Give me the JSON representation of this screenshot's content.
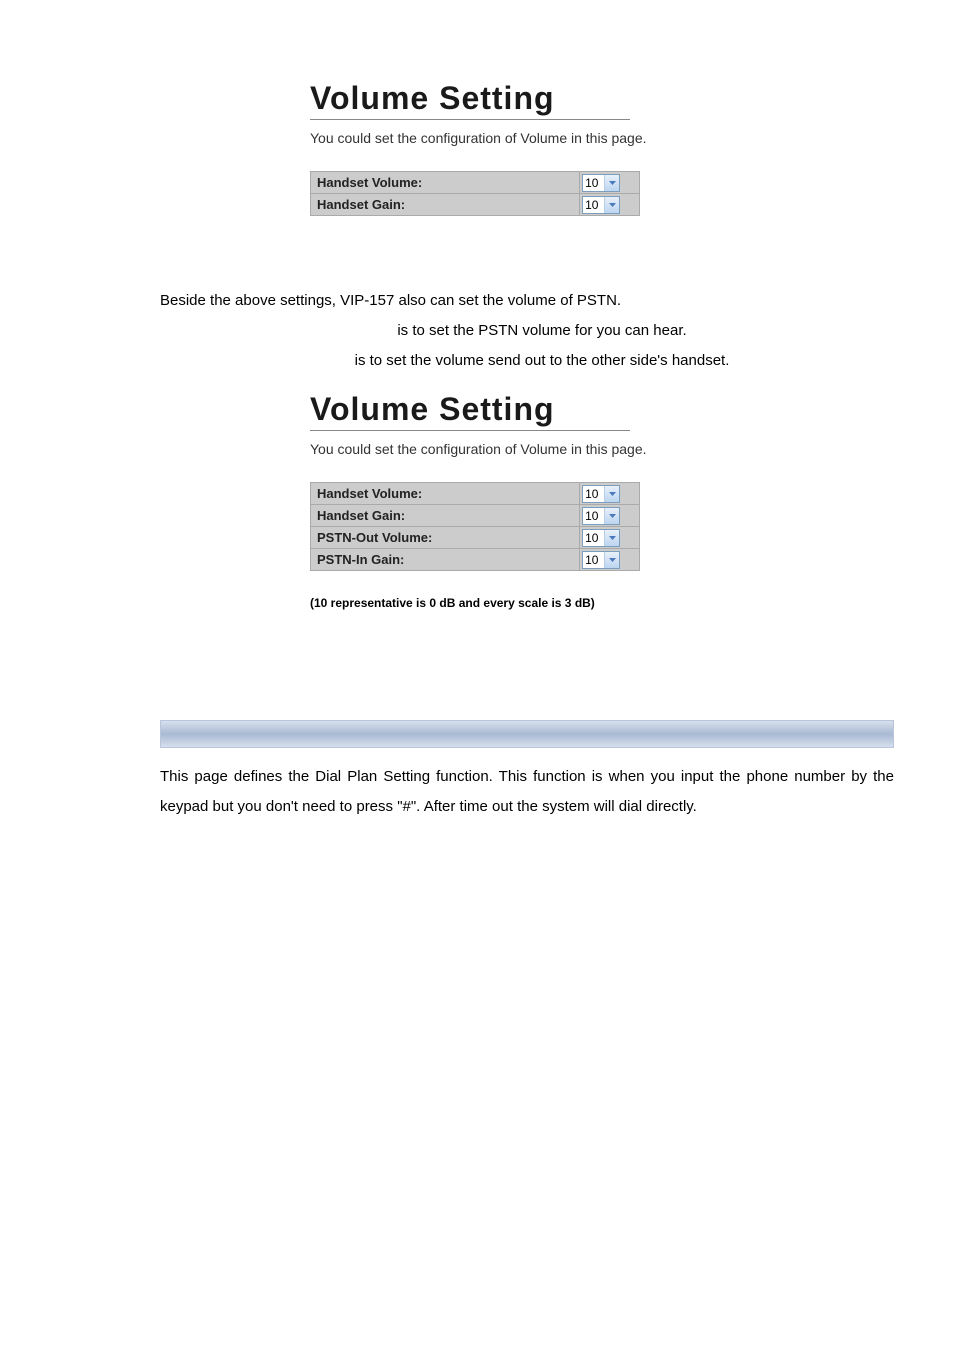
{
  "section1": {
    "title": "Volume Setting",
    "desc": "You could set the configuration of Volume in this page.",
    "rows": [
      {
        "label": "Handset Volume:",
        "value": "10"
      },
      {
        "label": "Handset Gain:",
        "value": "10"
      }
    ]
  },
  "middle": {
    "line1": "Beside the above settings, VIP-157 also can set the volume of PSTN.",
    "line2": "is to set the PSTN volume for you can hear.",
    "line3": "is to set the volume send out to the other side's handset."
  },
  "section2": {
    "title": "Volume Setting",
    "desc": "You could set the configuration of Volume in this page.",
    "rows": [
      {
        "label": "Handset Volume:",
        "value": "10"
      },
      {
        "label": "Handset Gain:",
        "value": "10"
      },
      {
        "label": "PSTN-Out Volume:",
        "value": "10"
      },
      {
        "label": "PSTN-In Gain:",
        "value": "10"
      }
    ]
  },
  "note": "(10 representative is 0 dB and every scale is 3 dB)",
  "dialplan": "This page defines the Dial Plan Setting function. This function is when you input the phone number by the keypad but you don't need to press \"#\". After time out the system will dial directly."
}
